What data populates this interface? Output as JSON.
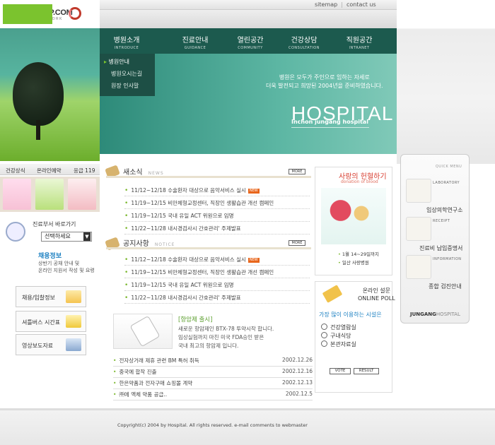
{
  "brand": {
    "name": "PSD SHOP.COM",
    "tagline": "EASY YOUR WORK"
  },
  "top_links": [
    "sitemap",
    "contact us"
  ],
  "nav": [
    {
      "label": "병원소개",
      "sub": "INTRODUCE",
      "active": true
    },
    {
      "label": "진료안내",
      "sub": "GUIDANCE"
    },
    {
      "label": "열린공간",
      "sub": "COMMUNITY"
    },
    {
      "label": "건강상담",
      "sub": "CONSULTATION"
    },
    {
      "label": "직원공간",
      "sub": "INTRANET"
    }
  ],
  "submenu": [
    "병원안내",
    "병원오시는길",
    "원장 인사말"
  ],
  "hero": {
    "line1": "병원은 모두가 주인으로 임하는 자세로",
    "line2": "더욱 발전되고 희망된 2004년을 준비하였습니다.",
    "title": "HOSPITAL",
    "subtitle": "Inchon jungang hospital"
  },
  "quick_strip": [
    "건강상식",
    "온라인예약",
    "응급 119"
  ],
  "dept": {
    "label": "진료부서 바로가기",
    "select_value": "선택하세요"
  },
  "recruit": {
    "title": "채용정보",
    "desc1": "상반기 공채 안내 및",
    "desc2": "온라인 지원서 작성 및 요령"
  },
  "left_buttons": [
    "채용/입찰정보",
    "셔틀버스 시간표",
    "영상보도자료"
  ],
  "news": {
    "title": "새소식",
    "tag": "NEWS",
    "more": "MORE",
    "items": [
      {
        "date": "11/12~12/18",
        "text": "수술환자 대상으로 음악서비스 실시",
        "new": "NEW"
      },
      {
        "date": "11/19~12/15",
        "text": "비만체형교정센터, 직장인 생활습관 개선 캠페인"
      },
      {
        "date": "11/19~12/15",
        "text": "국내 유일 ACT 위원으로 임명"
      },
      {
        "date": "11/22~11/28",
        "text": "내시경검사시 간호관리' 주제발표"
      }
    ]
  },
  "notice": {
    "title": "공지사항",
    "tag": "NOTICE",
    "more": "MORE",
    "items": [
      {
        "date": "11/12~12/18",
        "text": "수술환자 대상으로 음악서비스 실시",
        "new": "NEW"
      },
      {
        "date": "11/19~12/15",
        "text": "비만체형교정센터, 직장인 생활습관 개선 캠페인"
      },
      {
        "date": "11/19~12/15",
        "text": "국내 유일 ACT 위원으로 임명"
      },
      {
        "date": "11/22~11/28",
        "text": "내시경검사시 간호관리' 주제발표"
      }
    ]
  },
  "product": {
    "title": "[항암제 출시]",
    "desc1": "새로운 항암제인 BTX-78 투약시작 합니다.",
    "desc2": "임상실험까지 마친 미국 FDA승인 받은",
    "desc3": "국내 최고의 항암제 입니다."
  },
  "bottom_list": [
    {
      "text": "전자상거래 제휴 관련 BM 특허 취득",
      "date": "2002.12.26"
    },
    {
      "text": "중국에 합작 진출",
      "date": "2002.12.16"
    },
    {
      "text": "한은약품과 전자구매 쇼핑몰 계약",
      "date": "2002.12.13"
    },
    {
      "text": "㈜에 액체 약품 공급..",
      "date": "2002.12.5"
    }
  ],
  "donation": {
    "title": "사랑의 헌혈하기",
    "sub": "donation of blood",
    "line1": "1월 14~29일까지",
    "line2": "일산 사랑병원"
  },
  "poll": {
    "title1": "온라인 설문",
    "title2": "ONLINE POLL",
    "question": "가장 많이 이용하는 시설은",
    "options": [
      "건강열람실",
      "구내식당",
      "본관자료실"
    ],
    "vote": "VOTE",
    "result": "RESULT"
  },
  "quick_menu": {
    "head": "QUICK MENU",
    "items": [
      {
        "tag": "LABORATORY",
        "label": "임상의학연구소"
      },
      {
        "tag": "RECEIPT",
        "label": "진료비 납입증명서"
      },
      {
        "tag": "INFORMATION",
        "label": "종합 검진안내"
      }
    ],
    "foot_bold": "JUNGANG",
    "foot_light": "HOSPITAL"
  },
  "footer": {
    "copyright": "Copyright(c) 2004 by Hospital. All rights reserved. e-mail comments to webmaster"
  },
  "colors": {
    "nav": "#1c5a4e",
    "accent_green": "#7bc32e",
    "link_blue": "#1a7fc1",
    "donation_red": "#d73b2d"
  }
}
